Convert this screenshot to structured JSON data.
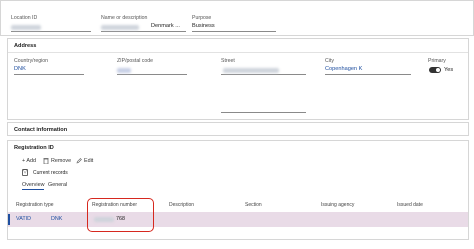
{
  "header": {
    "location_id_label": "Location ID",
    "name_label": "Name or description",
    "name_value": "Denmark ...",
    "purpose_label": "Purpose",
    "purpose_value": "Business"
  },
  "address": {
    "title": "Address",
    "country_label": "Country/region",
    "country_value": "DNK",
    "zip_label": "ZIP/postal code",
    "street_label": "Street",
    "city_label": "City",
    "city_value": "Copenhagen K",
    "primary_label": "Primary",
    "primary_value": "Yes",
    "primary_on": true
  },
  "contact": {
    "title": "Contact information"
  },
  "registration": {
    "title": "Registration ID",
    "add_label": "+ Add",
    "remove_label": "Remove",
    "edit_label": "Edit",
    "filter_label": "Current records",
    "tabs": [
      {
        "label": "Overview",
        "active": true
      },
      {
        "label": "General",
        "active": false
      }
    ],
    "columns": [
      "Registration type",
      "Registration number",
      "Description",
      "Section",
      "Issuing agency",
      "Issued date"
    ],
    "rows": [
      {
        "type": "VATID",
        "country": "DNK",
        "number_suffix": "768",
        "description": "",
        "section": "",
        "agency": "",
        "issued": ""
      }
    ]
  },
  "colors": {
    "accent": "#1f4fa0",
    "highlight": "#d6281f",
    "selected_row": "#e9dbe7"
  },
  "icons": [
    "trash-icon",
    "pencil-icon",
    "filter-icon",
    "toggle-icon"
  ]
}
